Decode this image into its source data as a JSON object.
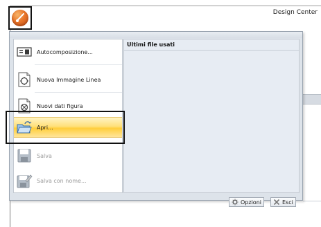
{
  "window": {
    "title": "Design Center"
  },
  "menu": {
    "commands": [
      {
        "label": "Autocomposizione...",
        "icon": "autocompose-icon",
        "enabled": true
      },
      {
        "label": "Nuova Immagine Linea",
        "icon": "new-line-image-icon",
        "enabled": true
      },
      {
        "label": "Nuovi dati figura",
        "icon": "new-figure-data-icon",
        "enabled": true
      },
      {
        "label": "Apri...",
        "icon": "open-folder-icon",
        "enabled": true,
        "highlighted": true
      },
      {
        "label": "Salva",
        "icon": "save-icon",
        "enabled": false
      },
      {
        "label": "Salva con nome...",
        "icon": "save-as-icon",
        "enabled": false
      }
    ],
    "recent_title": "Ultimi file usati",
    "footer": {
      "options_label": "Opzioni",
      "exit_label": "Esci"
    }
  },
  "colors": {
    "highlight": "#ffd85a",
    "menu_bg": "#dde3ea",
    "app_button": "#e9762a"
  }
}
